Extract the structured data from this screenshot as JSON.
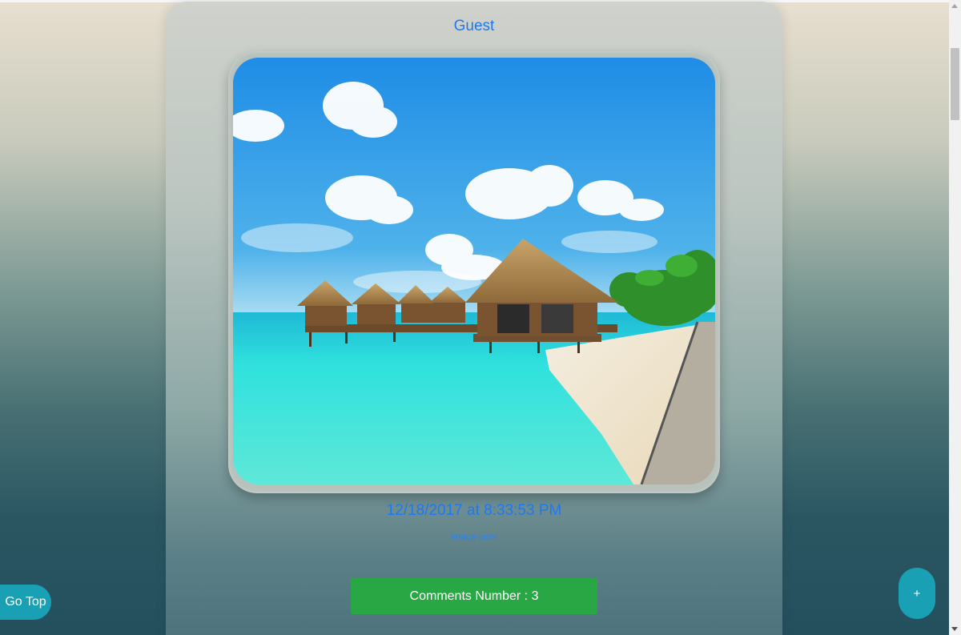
{
  "post": {
    "author": "Guest",
    "image_alt": "tropical beach with overwater bungalows",
    "date": "12/18/2017 at 8:33:53 PM",
    "type_label": "image post",
    "comments_button_label": "Comments Number : 3"
  },
  "controls": {
    "go_top_label": "Go Top",
    "fab_label": "+"
  },
  "colors": {
    "link_blue": "#1e78f0",
    "comments_green": "#2aa745",
    "floating_teal": "#1aa0b5"
  }
}
